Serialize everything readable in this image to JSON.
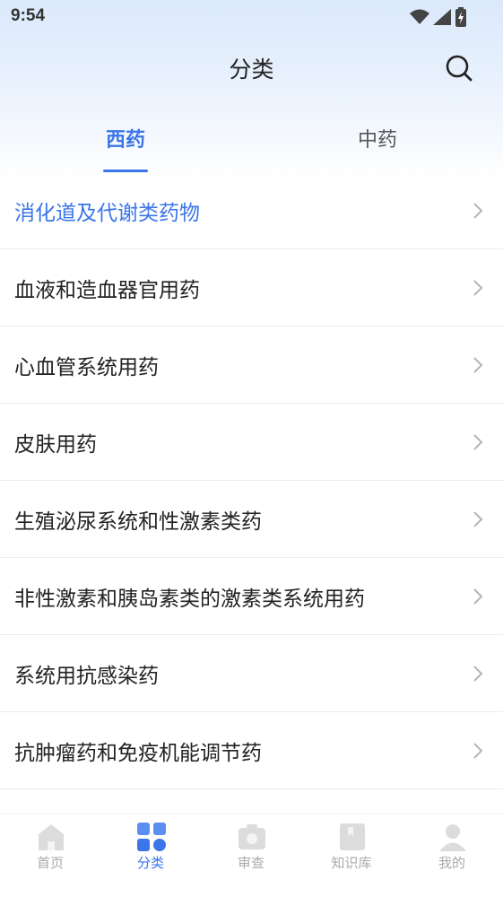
{
  "status_bar": {
    "time": "9:54"
  },
  "header": {
    "title": "分类"
  },
  "tabs": [
    {
      "label": "西药",
      "active": true
    },
    {
      "label": "中药",
      "active": false
    }
  ],
  "categories": [
    {
      "label": "消化道及代谢类药物",
      "active": true
    },
    {
      "label": "血液和造血器官用药"
    },
    {
      "label": "心血管系统用药"
    },
    {
      "label": "皮肤用药"
    },
    {
      "label": "生殖泌尿系统和性激素类药"
    },
    {
      "label": "非性激素和胰岛素类的激素类系统用药"
    },
    {
      "label": "系统用抗感染药"
    },
    {
      "label": "抗肿瘤药和免疫机能调节药"
    }
  ],
  "bottom_nav": [
    {
      "label": "首页",
      "icon": "home-icon"
    },
    {
      "label": "分类",
      "icon": "category-grid-icon",
      "active": true
    },
    {
      "label": "审查",
      "icon": "camera-icon"
    },
    {
      "label": "知识库",
      "icon": "book-icon"
    },
    {
      "label": "我的",
      "icon": "user-icon"
    }
  ],
  "colors": {
    "accent": "#3b76e8",
    "inactive": "#aaaaaa",
    "gradient_top": "#dbe9fb"
  }
}
